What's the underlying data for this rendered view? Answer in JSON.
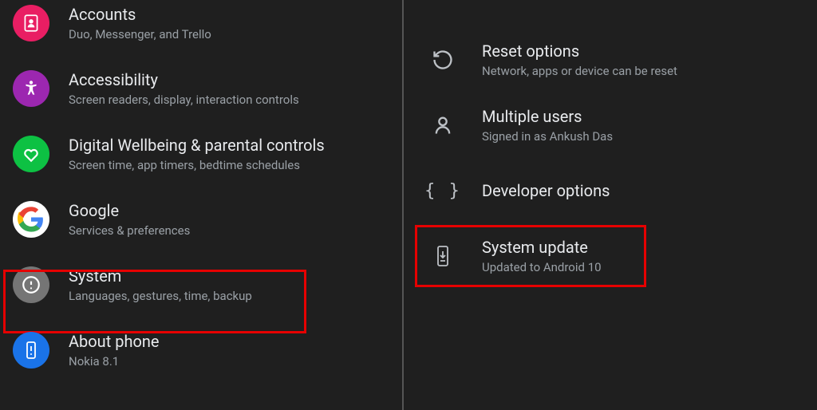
{
  "left": {
    "items": [
      {
        "title": "Accounts",
        "subtitle": "Duo, Messenger, and Trello"
      },
      {
        "title": "Accessibility",
        "subtitle": "Screen readers, display, interaction controls"
      },
      {
        "title": "Digital Wellbeing & parental controls",
        "subtitle": "Screen time, app timers, bedtime schedules"
      },
      {
        "title": "Google",
        "subtitle": "Services & preferences"
      },
      {
        "title": "System",
        "subtitle": "Languages, gestures, time, backup"
      },
      {
        "title": "About phone",
        "subtitle": "Nokia 8.1"
      }
    ]
  },
  "right": {
    "items": [
      {
        "title": "Reset options",
        "subtitle": "Network, apps or device can be reset"
      },
      {
        "title": "Multiple users",
        "subtitle": "Signed in as Ankush Das"
      },
      {
        "title": "Developer options",
        "subtitle": ""
      },
      {
        "title": "System update",
        "subtitle": "Updated to Android 10"
      }
    ]
  }
}
